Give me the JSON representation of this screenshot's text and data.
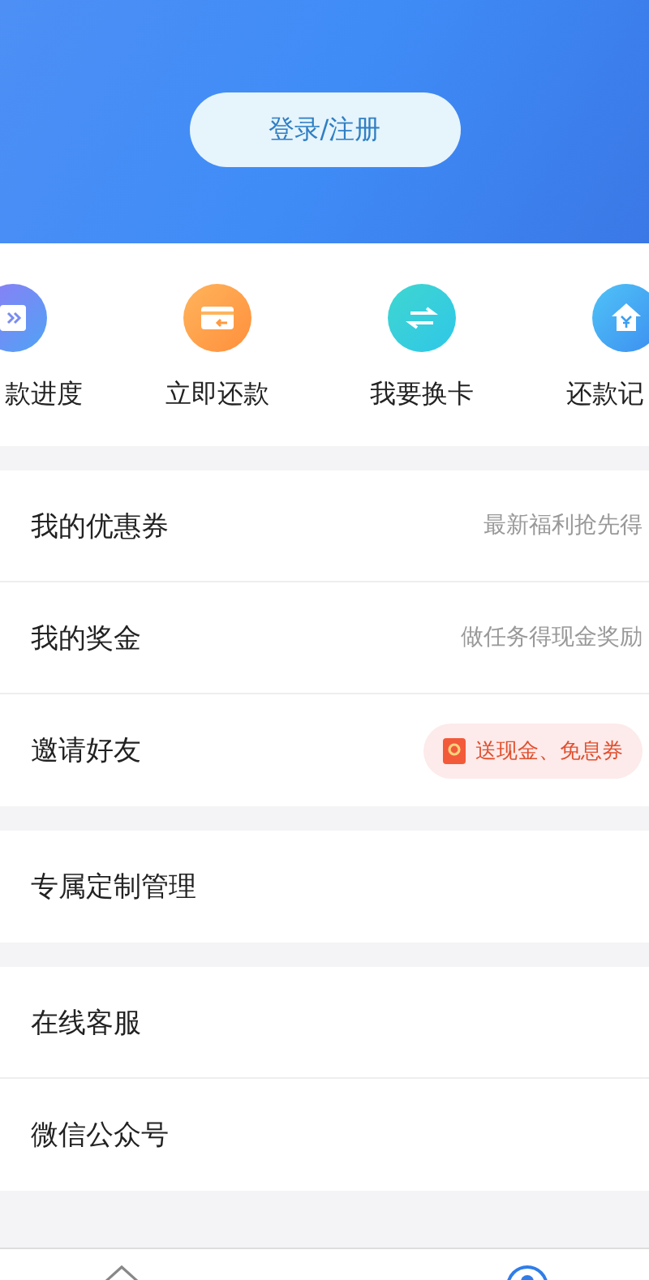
{
  "header": {
    "login_button": "登录/注册"
  },
  "shortcuts": [
    {
      "label": "款进度"
    },
    {
      "label": "立即还款"
    },
    {
      "label": "我要换卡"
    },
    {
      "label": "还款记"
    }
  ],
  "menu_groups": [
    [
      {
        "label": "我的优惠券",
        "kind": "hint",
        "extra": "最新福利抢先得"
      },
      {
        "label": "我的奖金",
        "kind": "hint",
        "extra": "做任务得现金奖励"
      },
      {
        "label": "邀请好友",
        "kind": "badge",
        "extra": "送现金、免息券"
      }
    ],
    [
      {
        "label": "专属定制管理",
        "kind": "plain"
      }
    ],
    [
      {
        "label": "在线客服",
        "kind": "plain"
      },
      {
        "label": "微信公众号",
        "kind": "plain"
      }
    ]
  ]
}
